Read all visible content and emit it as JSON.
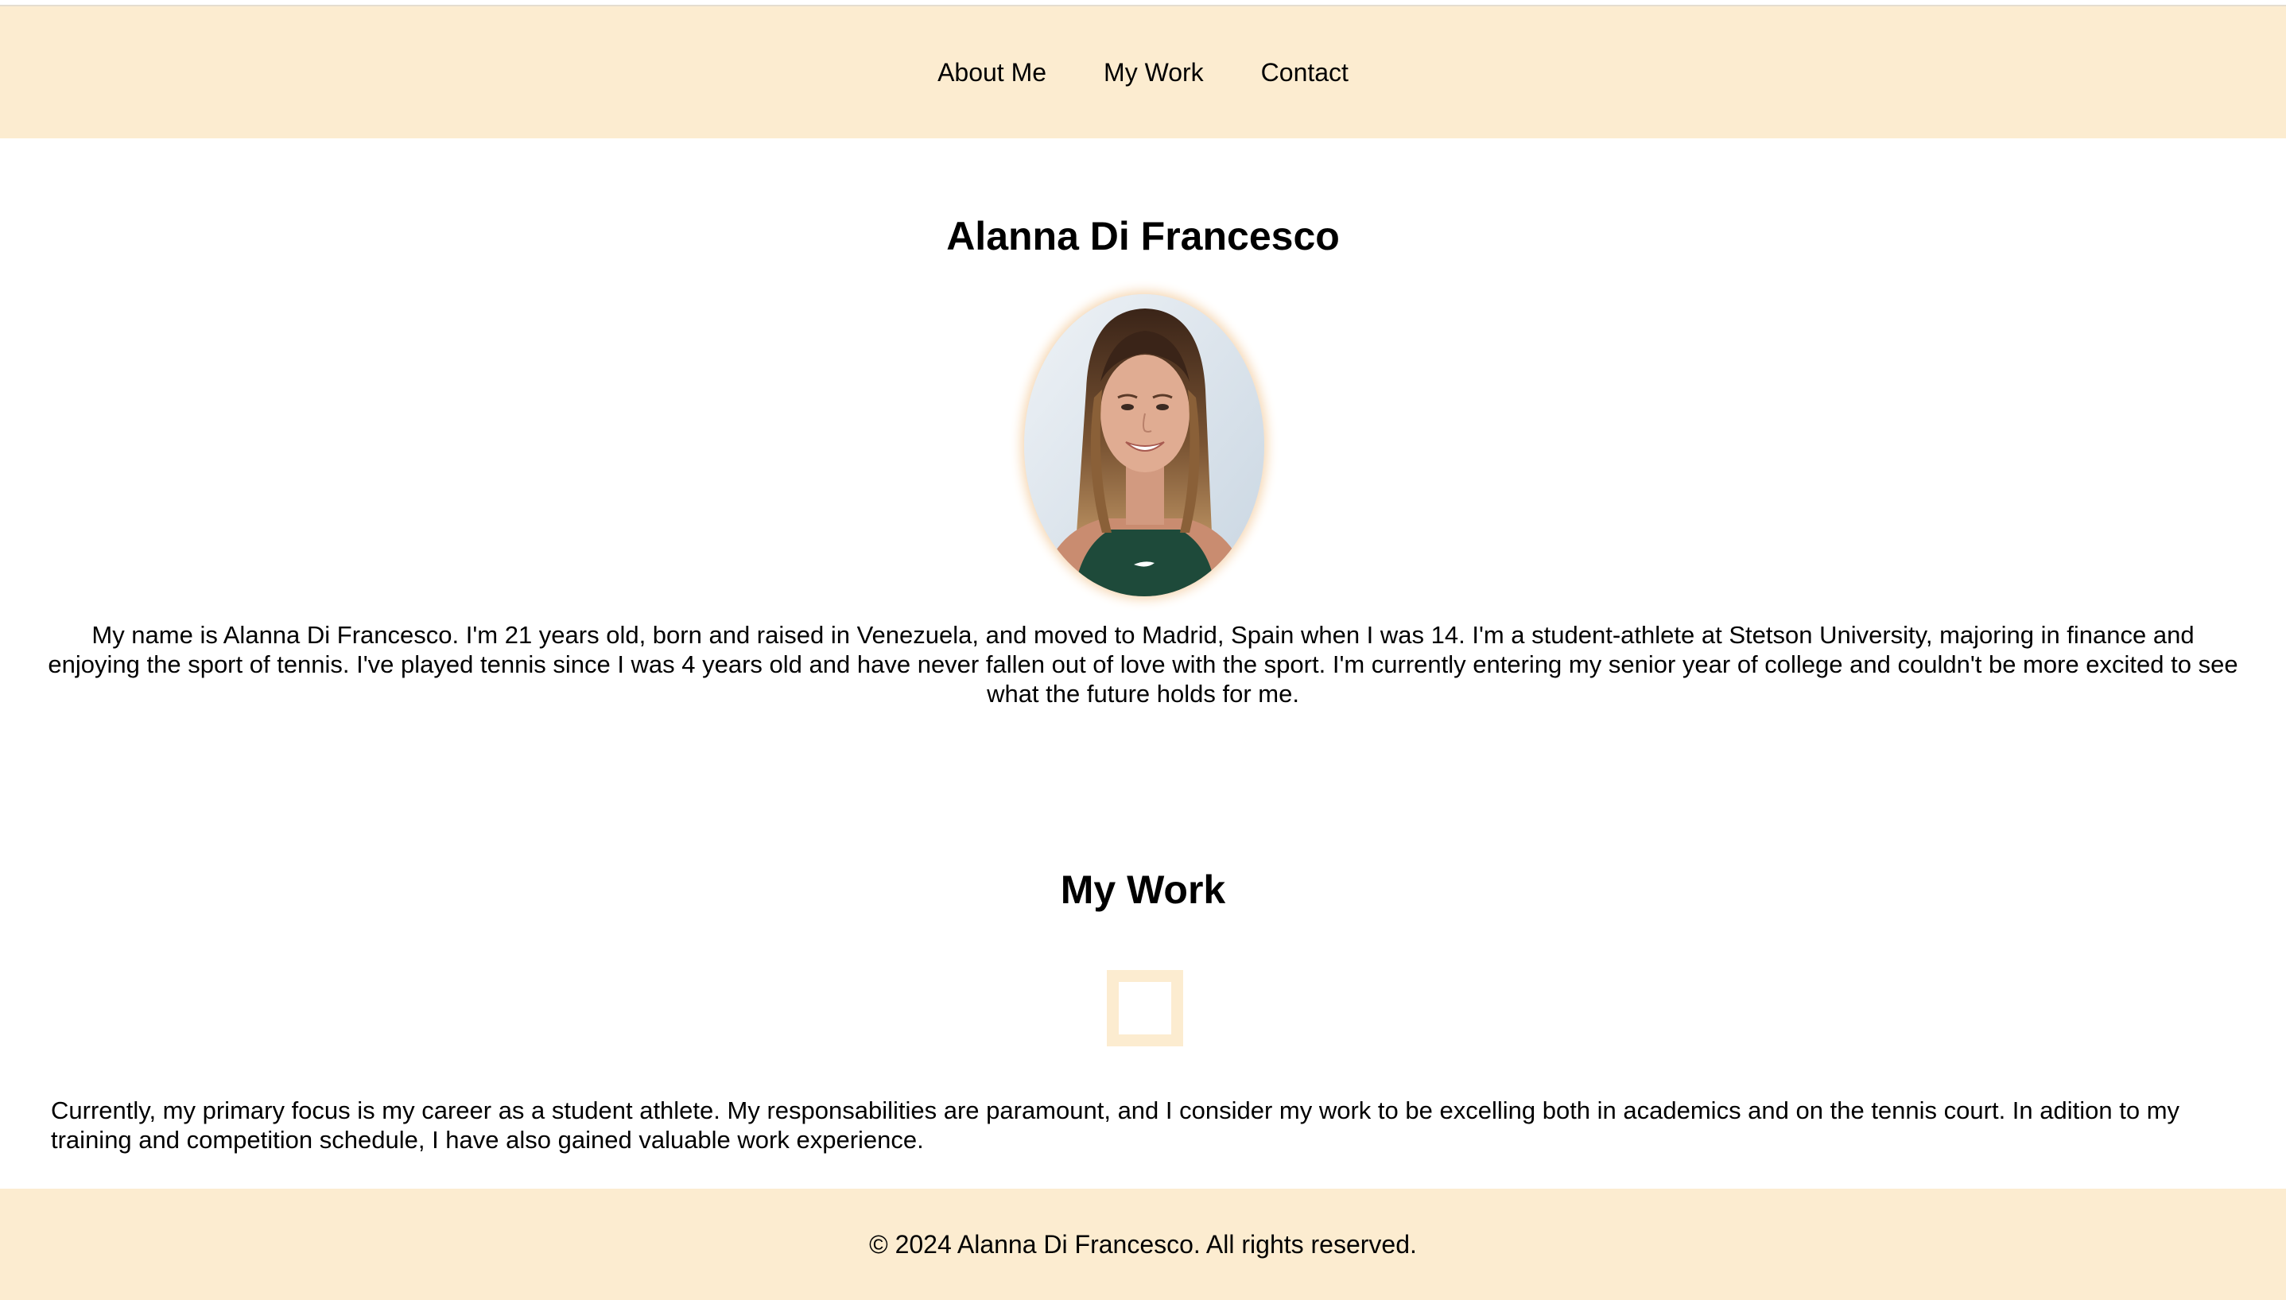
{
  "nav": {
    "items": [
      {
        "label": "About Me"
      },
      {
        "label": "My Work"
      },
      {
        "label": "Contact"
      }
    ]
  },
  "hero": {
    "name": "Alanna Di Francesco",
    "portrait_icon": "profile-photo",
    "bio": "My name is Alanna Di Francesco. I'm 21 years old, born and raised in Venezuela, and moved to Madrid, Spain when I was 14. I'm a student-athlete at Stetson University, majoring in finance and enjoying the sport of tennis. I've played tennis since I was 4 years old and have never fallen out of love with the sport. I'm currently entering my senior year of college and couldn't be more excited to see what the future holds for me."
  },
  "work": {
    "title": "My Work",
    "paragraph_1": "Currently, my primary focus is my career as a student athlete. My responsabilities are paramount, and I consider my work to be excelling both in academics and on the tennis court. In adition to my training and competition schedule, I have also gained valuable work experience."
  },
  "footer": {
    "text": "© 2024 Alanna Di Francesco. All rights reserved."
  },
  "colors": {
    "accent_bg": "#fcecd0",
    "text": "#000000",
    "background": "#ffffff"
  }
}
